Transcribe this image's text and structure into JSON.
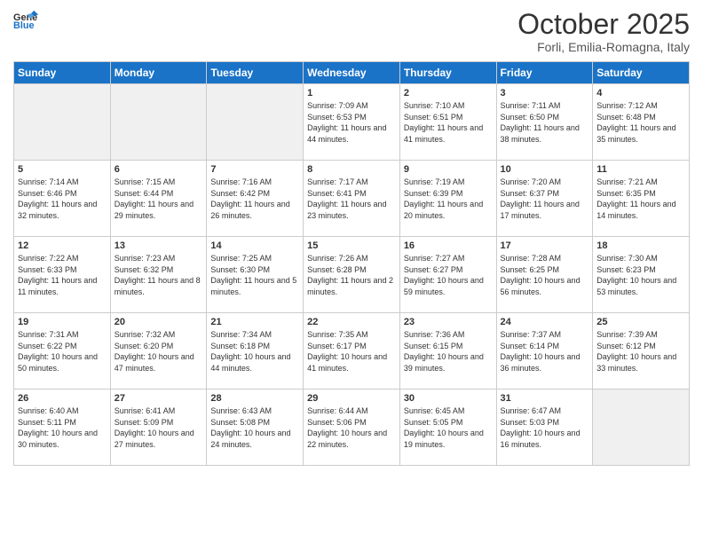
{
  "header": {
    "logo_general": "General",
    "logo_blue": "Blue",
    "month_title": "October 2025",
    "location": "Forli, Emilia-Romagna, Italy"
  },
  "weekdays": [
    "Sunday",
    "Monday",
    "Tuesday",
    "Wednesday",
    "Thursday",
    "Friday",
    "Saturday"
  ],
  "weeks": [
    [
      {
        "day": "",
        "sunrise": "",
        "sunset": "",
        "daylight": ""
      },
      {
        "day": "",
        "sunrise": "",
        "sunset": "",
        "daylight": ""
      },
      {
        "day": "",
        "sunrise": "",
        "sunset": "",
        "daylight": ""
      },
      {
        "day": "1",
        "sunrise": "Sunrise: 7:09 AM",
        "sunset": "Sunset: 6:53 PM",
        "daylight": "Daylight: 11 hours and 44 minutes."
      },
      {
        "day": "2",
        "sunrise": "Sunrise: 7:10 AM",
        "sunset": "Sunset: 6:51 PM",
        "daylight": "Daylight: 11 hours and 41 minutes."
      },
      {
        "day": "3",
        "sunrise": "Sunrise: 7:11 AM",
        "sunset": "Sunset: 6:50 PM",
        "daylight": "Daylight: 11 hours and 38 minutes."
      },
      {
        "day": "4",
        "sunrise": "Sunrise: 7:12 AM",
        "sunset": "Sunset: 6:48 PM",
        "daylight": "Daylight: 11 hours and 35 minutes."
      }
    ],
    [
      {
        "day": "5",
        "sunrise": "Sunrise: 7:14 AM",
        "sunset": "Sunset: 6:46 PM",
        "daylight": "Daylight: 11 hours and 32 minutes."
      },
      {
        "day": "6",
        "sunrise": "Sunrise: 7:15 AM",
        "sunset": "Sunset: 6:44 PM",
        "daylight": "Daylight: 11 hours and 29 minutes."
      },
      {
        "day": "7",
        "sunrise": "Sunrise: 7:16 AM",
        "sunset": "Sunset: 6:42 PM",
        "daylight": "Daylight: 11 hours and 26 minutes."
      },
      {
        "day": "8",
        "sunrise": "Sunrise: 7:17 AM",
        "sunset": "Sunset: 6:41 PM",
        "daylight": "Daylight: 11 hours and 23 minutes."
      },
      {
        "day": "9",
        "sunrise": "Sunrise: 7:19 AM",
        "sunset": "Sunset: 6:39 PM",
        "daylight": "Daylight: 11 hours and 20 minutes."
      },
      {
        "day": "10",
        "sunrise": "Sunrise: 7:20 AM",
        "sunset": "Sunset: 6:37 PM",
        "daylight": "Daylight: 11 hours and 17 minutes."
      },
      {
        "day": "11",
        "sunrise": "Sunrise: 7:21 AM",
        "sunset": "Sunset: 6:35 PM",
        "daylight": "Daylight: 11 hours and 14 minutes."
      }
    ],
    [
      {
        "day": "12",
        "sunrise": "Sunrise: 7:22 AM",
        "sunset": "Sunset: 6:33 PM",
        "daylight": "Daylight: 11 hours and 11 minutes."
      },
      {
        "day": "13",
        "sunrise": "Sunrise: 7:23 AM",
        "sunset": "Sunset: 6:32 PM",
        "daylight": "Daylight: 11 hours and 8 minutes."
      },
      {
        "day": "14",
        "sunrise": "Sunrise: 7:25 AM",
        "sunset": "Sunset: 6:30 PM",
        "daylight": "Daylight: 11 hours and 5 minutes."
      },
      {
        "day": "15",
        "sunrise": "Sunrise: 7:26 AM",
        "sunset": "Sunset: 6:28 PM",
        "daylight": "Daylight: 11 hours and 2 minutes."
      },
      {
        "day": "16",
        "sunrise": "Sunrise: 7:27 AM",
        "sunset": "Sunset: 6:27 PM",
        "daylight": "Daylight: 10 hours and 59 minutes."
      },
      {
        "day": "17",
        "sunrise": "Sunrise: 7:28 AM",
        "sunset": "Sunset: 6:25 PM",
        "daylight": "Daylight: 10 hours and 56 minutes."
      },
      {
        "day": "18",
        "sunrise": "Sunrise: 7:30 AM",
        "sunset": "Sunset: 6:23 PM",
        "daylight": "Daylight: 10 hours and 53 minutes."
      }
    ],
    [
      {
        "day": "19",
        "sunrise": "Sunrise: 7:31 AM",
        "sunset": "Sunset: 6:22 PM",
        "daylight": "Daylight: 10 hours and 50 minutes."
      },
      {
        "day": "20",
        "sunrise": "Sunrise: 7:32 AM",
        "sunset": "Sunset: 6:20 PM",
        "daylight": "Daylight: 10 hours and 47 minutes."
      },
      {
        "day": "21",
        "sunrise": "Sunrise: 7:34 AM",
        "sunset": "Sunset: 6:18 PM",
        "daylight": "Daylight: 10 hours and 44 minutes."
      },
      {
        "day": "22",
        "sunrise": "Sunrise: 7:35 AM",
        "sunset": "Sunset: 6:17 PM",
        "daylight": "Daylight: 10 hours and 41 minutes."
      },
      {
        "day": "23",
        "sunrise": "Sunrise: 7:36 AM",
        "sunset": "Sunset: 6:15 PM",
        "daylight": "Daylight: 10 hours and 39 minutes."
      },
      {
        "day": "24",
        "sunrise": "Sunrise: 7:37 AM",
        "sunset": "Sunset: 6:14 PM",
        "daylight": "Daylight: 10 hours and 36 minutes."
      },
      {
        "day": "25",
        "sunrise": "Sunrise: 7:39 AM",
        "sunset": "Sunset: 6:12 PM",
        "daylight": "Daylight: 10 hours and 33 minutes."
      }
    ],
    [
      {
        "day": "26",
        "sunrise": "Sunrise: 6:40 AM",
        "sunset": "Sunset: 5:11 PM",
        "daylight": "Daylight: 10 hours and 30 minutes."
      },
      {
        "day": "27",
        "sunrise": "Sunrise: 6:41 AM",
        "sunset": "Sunset: 5:09 PM",
        "daylight": "Daylight: 10 hours and 27 minutes."
      },
      {
        "day": "28",
        "sunrise": "Sunrise: 6:43 AM",
        "sunset": "Sunset: 5:08 PM",
        "daylight": "Daylight: 10 hours and 24 minutes."
      },
      {
        "day": "29",
        "sunrise": "Sunrise: 6:44 AM",
        "sunset": "Sunset: 5:06 PM",
        "daylight": "Daylight: 10 hours and 22 minutes."
      },
      {
        "day": "30",
        "sunrise": "Sunrise: 6:45 AM",
        "sunset": "Sunset: 5:05 PM",
        "daylight": "Daylight: 10 hours and 19 minutes."
      },
      {
        "day": "31",
        "sunrise": "Sunrise: 6:47 AM",
        "sunset": "Sunset: 5:03 PM",
        "daylight": "Daylight: 10 hours and 16 minutes."
      },
      {
        "day": "",
        "sunrise": "",
        "sunset": "",
        "daylight": ""
      }
    ]
  ]
}
